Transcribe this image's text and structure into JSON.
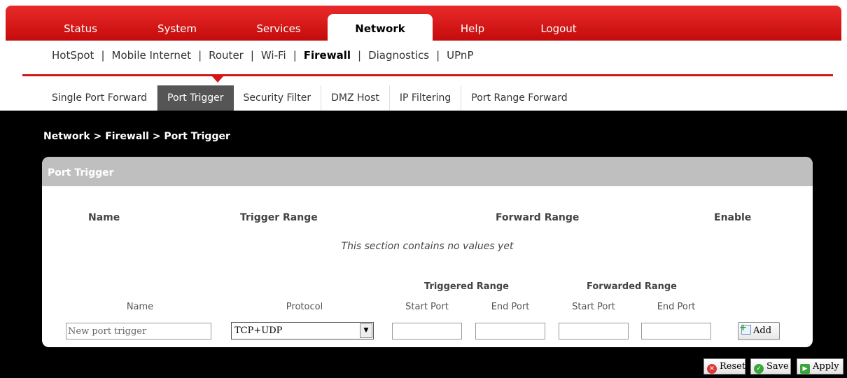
{
  "main_nav": {
    "tabs": [
      {
        "label": "Status"
      },
      {
        "label": "System"
      },
      {
        "label": "Services"
      },
      {
        "label": "Network"
      },
      {
        "label": "Help"
      },
      {
        "label": "Logout"
      }
    ],
    "active": "Network"
  },
  "sub_nav": {
    "items": [
      {
        "label": "HotSpot"
      },
      {
        "label": "Mobile Internet"
      },
      {
        "label": "Router"
      },
      {
        "label": "Wi-Fi"
      },
      {
        "label": "Firewall"
      },
      {
        "label": "Diagnostics"
      },
      {
        "label": "UPnP"
      }
    ],
    "separator": "|",
    "active": "Firewall"
  },
  "firewall_tabs": {
    "items": [
      {
        "label": "Single Port Forward"
      },
      {
        "label": "Port Trigger"
      },
      {
        "label": "Security Filter"
      },
      {
        "label": "DMZ Host"
      },
      {
        "label": "IP Filtering"
      },
      {
        "label": "Port Range Forward"
      }
    ],
    "active": "Port Trigger"
  },
  "breadcrumb": "Network > Firewall > Port Trigger",
  "panel": {
    "title": "Port Trigger",
    "columns": {
      "name": "Name",
      "trigger_range": "Trigger Range",
      "forward_range": "Forward Range",
      "enable": "Enable"
    },
    "empty_message": "This section contains no values yet",
    "form": {
      "group_triggered": "Triggered Range",
      "group_forwarded": "Forwarded Range",
      "labels": {
        "name": "Name",
        "protocol": "Protocol",
        "trig_start": "Start Port",
        "trig_end": "End Port",
        "fwd_start": "Start Port",
        "fwd_end": "End Port"
      },
      "name_placeholder": "New port trigger",
      "protocol_value": "TCP+UDP",
      "trig_start_value": "",
      "trig_end_value": "",
      "fwd_start_value": "",
      "fwd_end_value": "",
      "add_label": "Add"
    }
  },
  "footer_buttons": {
    "reset": "Reset",
    "save": "Save",
    "apply": "Apply"
  },
  "colors": {
    "nav_red": "#d51616",
    "panel_header": "#bfbfbf",
    "active_tab_bg": "#555555",
    "page_bg": "#000000"
  }
}
